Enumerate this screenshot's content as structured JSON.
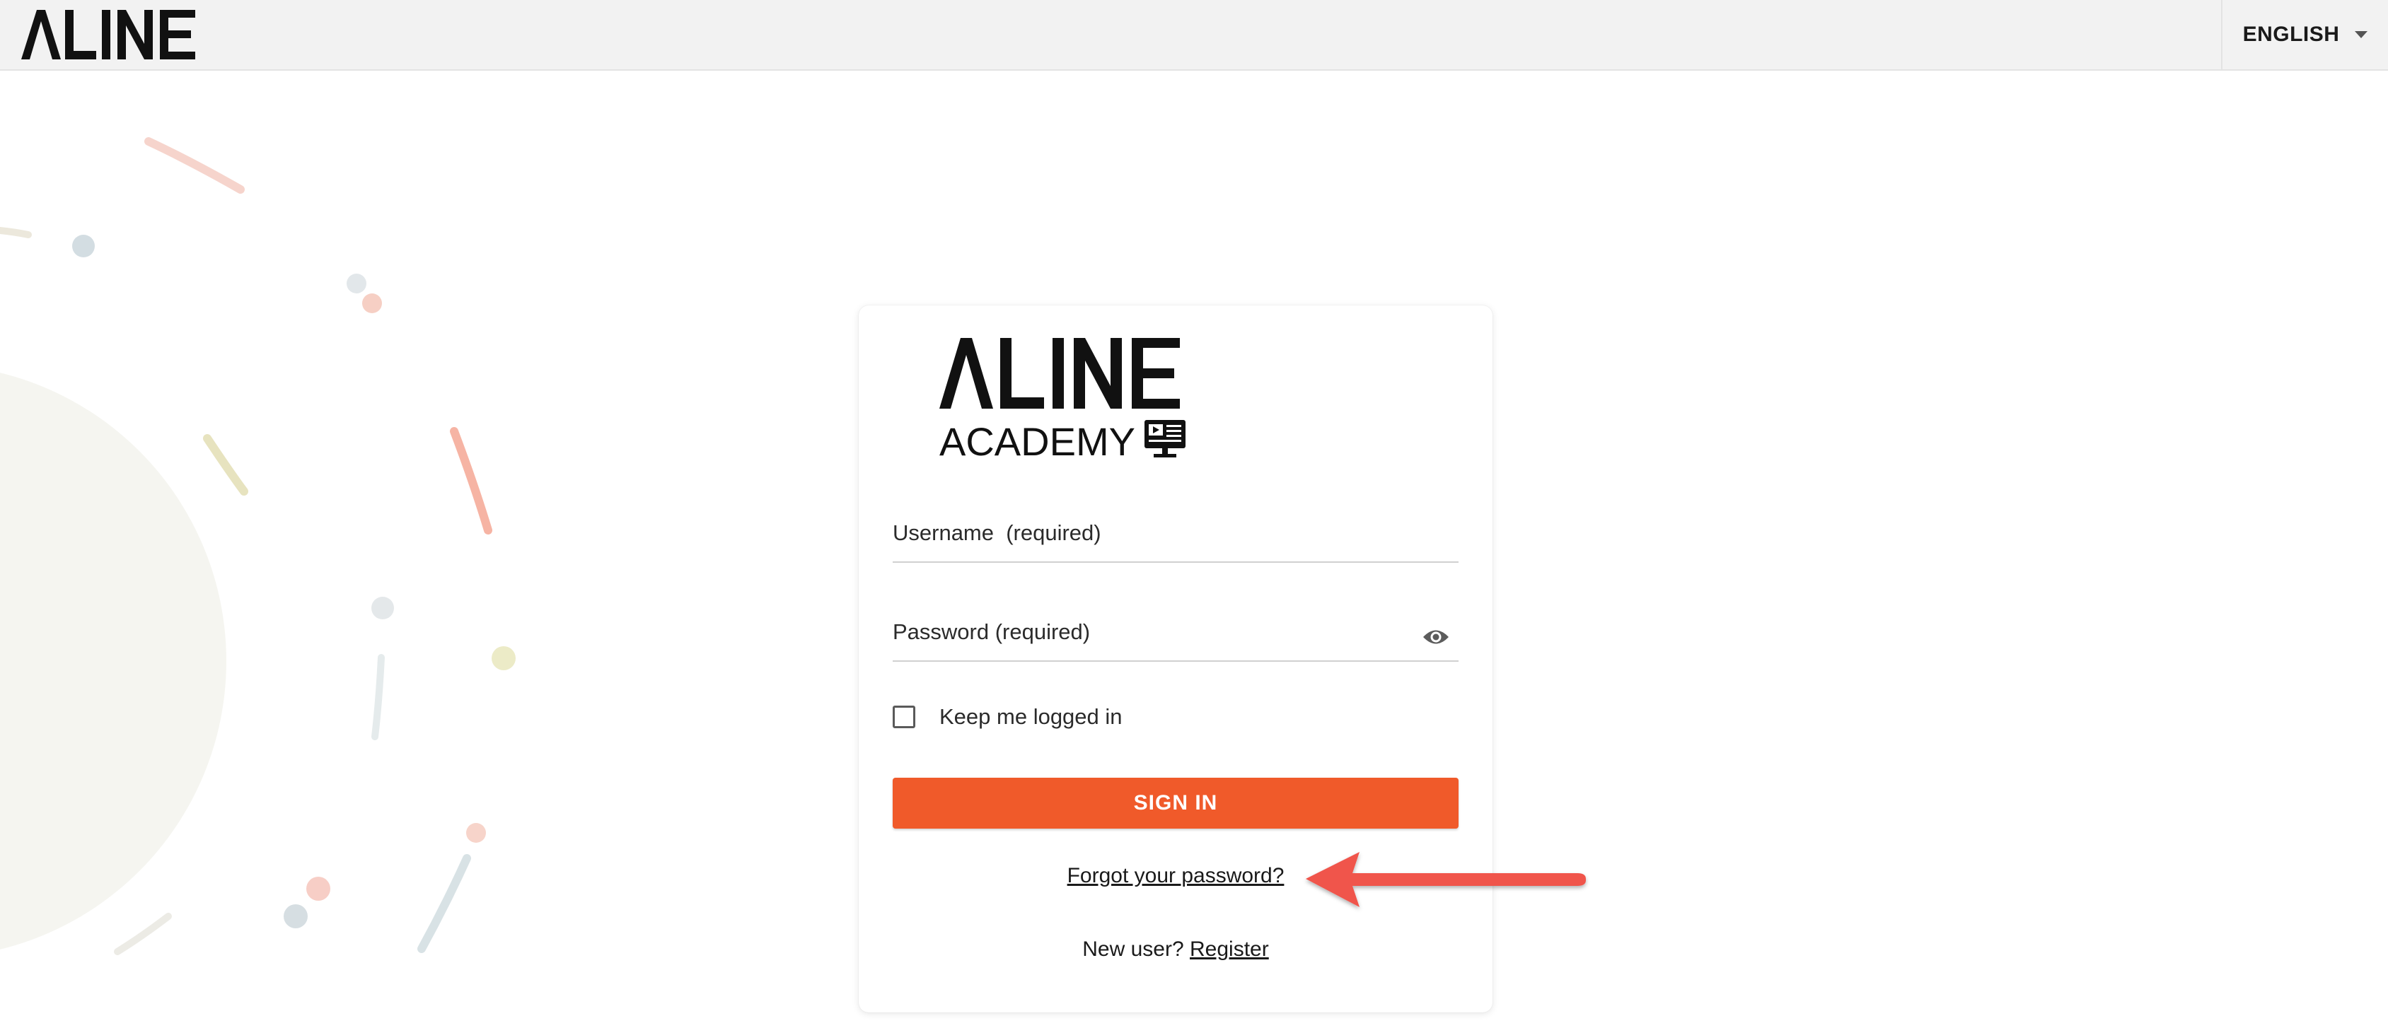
{
  "brand": {
    "name": "ALINE",
    "subtitle": "ACADEMY",
    "accent_color": "#f05a2a"
  },
  "header": {
    "language": "ENGLISH",
    "language_icon": "caret-down-icon"
  },
  "login": {
    "username_label": "Username  (required)",
    "username_value": "",
    "password_label": "Password (required)",
    "password_value": "",
    "show_password_icon": "eye-icon",
    "remember_label": "Keep me logged in",
    "remember_checked": false,
    "signin_label": "SIGN IN",
    "forgot_label": "Forgot your password?",
    "new_user_text": "New user?",
    "register_label": "Register"
  },
  "annotation": {
    "icon": "red-arrow-icon",
    "color": "#f0544c"
  }
}
